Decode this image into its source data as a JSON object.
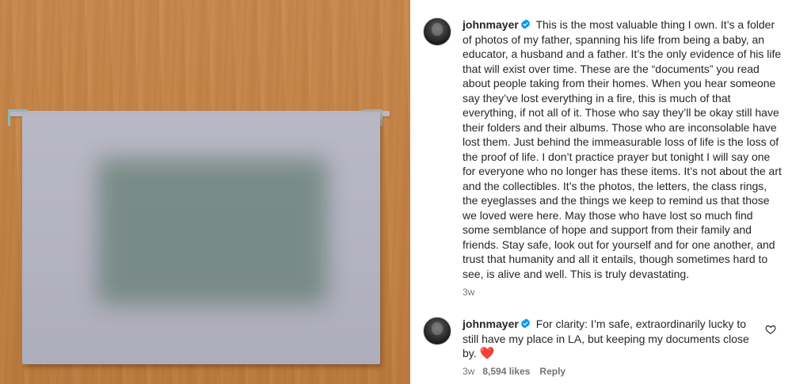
{
  "photo": {
    "description_icon": "hanging-file-folder"
  },
  "post": {
    "username": "johnmayer",
    "caption": "This is the most valuable thing I own. It’s a folder of photos of my father, spanning his life from being a baby, an educator, a husband and a father. It’s the only evidence of his life that will exist over time. These are the “documents” you read about people taking from their homes. When you hear someone say they’ve lost everything in a fire, this is much of that everything, if not all of it. Those who say they’ll be okay still have their folders and their albums. Those who are inconsolable have lost them. Just behind the immeasurable loss of life is the loss of the proof of life. I don’t practice prayer but tonight I will say one for everyone who no longer has these items. It’s not about the art and the collectibles. It’s the photos, the letters, the class rings, the eyeglasses and the things we keep to remind us that those we loved were here. May those who have lost so much find some semblance of hope and support from their family and friends. Stay safe, look out for yourself and for one another, and trust that humanity and all it entails, though sometimes hard to see, is alive and well. This is truly devastating.",
    "time_ago": "3w"
  },
  "comment": {
    "username": "johnmayer",
    "text": "For clarity: I’m safe, extraordinarily lucky to still have my place in LA, but keeping my documents close by.",
    "emoji": "❤️",
    "time_ago": "3w",
    "likes": "8,594 likes",
    "reply_label": "Reply"
  },
  "colors": {
    "verified_blue": "#0095f6",
    "text": "#262626",
    "meta": "#737373",
    "heart_red": "#e0242f"
  }
}
